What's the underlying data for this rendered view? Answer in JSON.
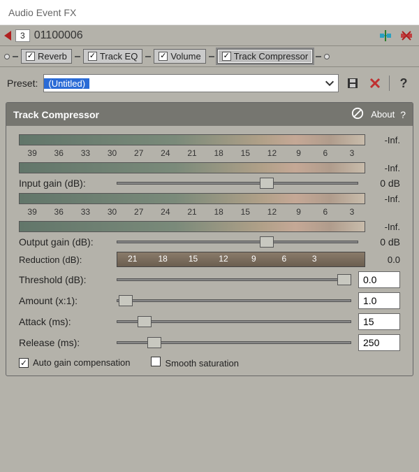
{
  "window": {
    "title": "Audio Event FX"
  },
  "secondbar": {
    "track_number": "3",
    "track_name": "01100006"
  },
  "chain": {
    "tabs": [
      {
        "label": "Reverb",
        "checked": true,
        "selected": false
      },
      {
        "label": "Track EQ",
        "checked": true,
        "selected": false
      },
      {
        "label": "Volume",
        "checked": true,
        "selected": false
      },
      {
        "label": "Track Compressor",
        "checked": true,
        "selected": true
      }
    ]
  },
  "preset": {
    "label": "Preset:",
    "value": "(Untitled)"
  },
  "panel": {
    "title": "Track Compressor",
    "about": "About",
    "meters": {
      "in_top_val": "-Inf.",
      "in_bot_val": "-Inf.",
      "out_top_val": "-Inf.",
      "out_bot_val": "-Inf.",
      "ruler_db": [
        "39",
        "36",
        "33",
        "30",
        "27",
        "24",
        "21",
        "18",
        "15",
        "12",
        "9",
        "6",
        "3"
      ]
    },
    "input_gain": {
      "label": "Input gain (dB):",
      "value": "0 dB",
      "pos_pct": 62
    },
    "output_gain": {
      "label": "Output gain (dB):",
      "value": "0 dB",
      "pos_pct": 62
    },
    "reduction": {
      "label": "Reduction (dB):",
      "value": "0.0",
      "ruler": [
        "21",
        "18",
        "15",
        "12",
        "9",
        "6",
        "3"
      ]
    },
    "threshold": {
      "label": "Threshold (dB):",
      "value": "0.0",
      "pos_pct": 97
    },
    "amount": {
      "label": "Amount (x:1):",
      "value": "1.0",
      "pos_pct": 4
    },
    "attack": {
      "label": "Attack (ms):",
      "value": "15",
      "pos_pct": 12
    },
    "release": {
      "label": "Release (ms):",
      "value": "250",
      "pos_pct": 16
    },
    "auto_gain": {
      "label": "Auto gain compensation",
      "checked": true
    },
    "smooth_sat": {
      "label": "Smooth saturation",
      "checked": false
    }
  }
}
